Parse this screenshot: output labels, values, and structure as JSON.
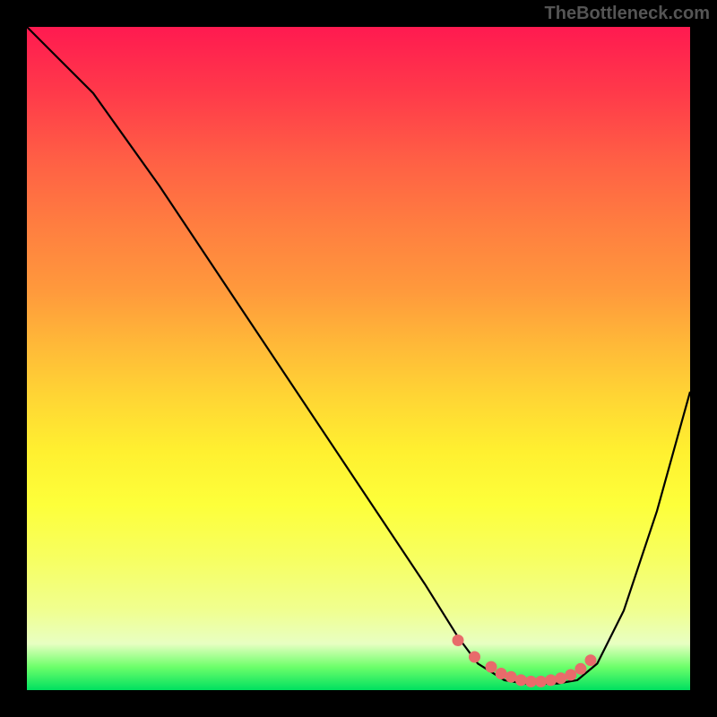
{
  "watermark": "TheBottleneck.com",
  "colors": {
    "curve": "#000000",
    "marker": "#e86b6b"
  },
  "chart_data": {
    "type": "line",
    "title": "",
    "xlabel": "",
    "ylabel": "",
    "xlim": [
      0,
      100
    ],
    "ylim": [
      0,
      100
    ],
    "series": [
      {
        "name": "bottleneck-curve",
        "x": [
          0,
          4,
          10,
          20,
          30,
          40,
          50,
          60,
          65,
          68,
          72,
          75,
          80,
          83,
          86,
          90,
          95,
          100
        ],
        "y": [
          100,
          96,
          90,
          76,
          61,
          46,
          31,
          16,
          8,
          4,
          1.5,
          1,
          1,
          1.5,
          4,
          12,
          27,
          45
        ]
      }
    ],
    "markers": {
      "name": "valley-floor",
      "x": [
        65,
        67.5,
        70,
        71.5,
        73,
        74.5,
        76,
        77.5,
        79,
        80.5,
        82,
        83.5,
        85
      ],
      "y": [
        7.5,
        5,
        3.5,
        2.5,
        2,
        1.5,
        1.3,
        1.3,
        1.5,
        1.8,
        2.3,
        3.2,
        4.5
      ],
      "color": "#e86b6b",
      "size": 6.5
    }
  }
}
